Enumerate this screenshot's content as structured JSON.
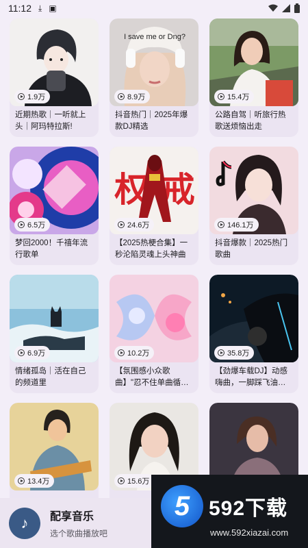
{
  "status": {
    "time": "11:12"
  },
  "cards": [
    {
      "plays": "1.9万",
      "title": "近期热歌｜一听就上头｜阿玛特拉斯!"
    },
    {
      "plays": "8.9万",
      "title": "抖音热门｜2025年爆款DJ精选"
    },
    {
      "plays": "15.4万",
      "title": "公路自驾｜听旅行热歌送烦恼出走"
    },
    {
      "plays": "6.5万",
      "title": "梦回2000！千禧年流行歌单"
    },
    {
      "plays": "24.6万",
      "title": "【2025热梗合集】一秒沦陷灵魂上头神曲"
    },
    {
      "plays": "146.1万",
      "title": "抖音爆款｜2025热门歌曲"
    },
    {
      "plays": "6.9万",
      "title": "情绪孤岛｜活在自己的频道里"
    },
    {
      "plays": "10.2万",
      "title": "【氛围感小众歌曲】\"忍不住单曲循环！\""
    },
    {
      "plays": "35.8万",
      "title": "【劲爆车载DJ】动感嗨曲，一脚踩飞油箱盖"
    },
    {
      "plays": "13.4万",
      "title": ""
    },
    {
      "plays": "15.6万",
      "title": ""
    },
    {
      "plays": "",
      "title": ""
    }
  ],
  "thumb_text": {
    "cap": "I save me or Dng?",
    "poster": "权 戒"
  },
  "player": {
    "title": "配享音乐",
    "subtitle": "选个歌曲播放吧",
    "icon": "music-note-icon"
  },
  "watermark": {
    "badge": "5",
    "logo_text": "592下载",
    "url": "www.592xiazai.com"
  }
}
